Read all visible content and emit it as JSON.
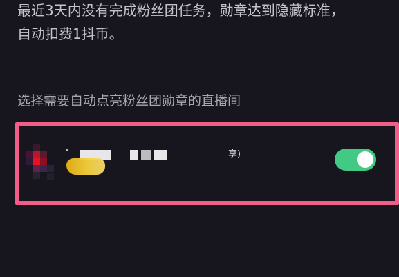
{
  "description": {
    "line1": "最近3天内没有完成粉丝团任务，勋章达到隐藏标准，",
    "line2": "自动扣费1抖币。"
  },
  "section": {
    "title": "选择需要自动点亮粉丝团勋章的直播间"
  },
  "room": {
    "name_suffix": "享)",
    "auto_light_enabled": true
  },
  "colors": {
    "background": "#17161f",
    "highlight_border": "#f25d8a",
    "toggle_on": "#42c983",
    "badge": "#f3c82a"
  }
}
